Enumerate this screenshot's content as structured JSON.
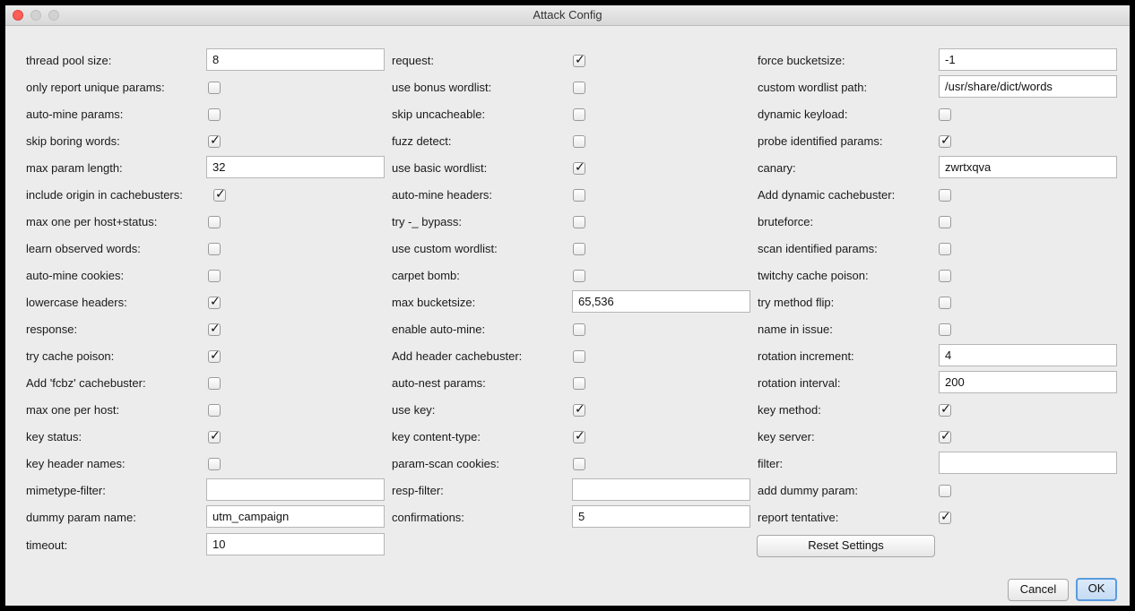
{
  "window": {
    "title": "Attack Config"
  },
  "col1": {
    "thread_pool_size": {
      "label": "thread pool size:",
      "value": "8"
    },
    "only_report_unique_params": {
      "label": "only report unique params:",
      "checked": false
    },
    "auto_mine_params": {
      "label": "auto-mine params:",
      "checked": false
    },
    "skip_boring_words": {
      "label": "skip boring words:",
      "checked": true
    },
    "max_param_length": {
      "label": "max param length:",
      "value": "32"
    },
    "include_origin_in_cachebusters": {
      "label": "include origin in cachebusters:",
      "checked": true
    },
    "max_one_per_host_status": {
      "label": "max one per host+status:",
      "checked": false
    },
    "learn_observed_words": {
      "label": "learn observed words:",
      "checked": false
    },
    "auto_mine_cookies": {
      "label": "auto-mine cookies:",
      "checked": false
    },
    "lowercase_headers": {
      "label": "lowercase headers:",
      "checked": true
    },
    "response": {
      "label": "response:",
      "checked": true
    },
    "try_cache_poison": {
      "label": "try cache poison:",
      "checked": true
    },
    "add_fcbz_cachebuster": {
      "label": "Add 'fcbz' cachebuster:",
      "checked": false
    },
    "max_one_per_host": {
      "label": "max one per host:",
      "checked": false
    },
    "key_status": {
      "label": "key status:",
      "checked": true
    },
    "key_header_names": {
      "label": "key header names:",
      "checked": false
    },
    "mimetype_filter": {
      "label": "mimetype-filter:",
      "value": ""
    },
    "dummy_param_name": {
      "label": "dummy param name:",
      "value": "utm_campaign"
    },
    "timeout": {
      "label": "timeout:",
      "value": "10"
    }
  },
  "col2": {
    "request": {
      "label": "request:",
      "checked": true
    },
    "use_bonus_wordlist": {
      "label": "use bonus wordlist:",
      "checked": false
    },
    "skip_uncacheable": {
      "label": "skip uncacheable:",
      "checked": false
    },
    "fuzz_detect": {
      "label": "fuzz detect:",
      "checked": false
    },
    "use_basic_wordlist": {
      "label": "use basic wordlist:",
      "checked": true
    },
    "auto_mine_headers": {
      "label": "auto-mine headers:",
      "checked": false
    },
    "try_bypass": {
      "label": "try -_ bypass:",
      "checked": false
    },
    "use_custom_wordlist": {
      "label": "use custom wordlist:",
      "checked": false
    },
    "carpet_bomb": {
      "label": "carpet bomb:",
      "checked": false
    },
    "max_bucketsize": {
      "label": "max bucketsize:",
      "value": "65,536"
    },
    "enable_auto_mine": {
      "label": "enable auto-mine:",
      "checked": false
    },
    "add_header_cachebuster": {
      "label": "Add header cachebuster:",
      "checked": false
    },
    "auto_nest_params": {
      "label": "auto-nest params:",
      "checked": false
    },
    "use_key": {
      "label": "use key:",
      "checked": true
    },
    "key_content_type": {
      "label": "key content-type:",
      "checked": true
    },
    "param_scan_cookies": {
      "label": "param-scan cookies:",
      "checked": false
    },
    "resp_filter": {
      "label": "resp-filter:",
      "value": ""
    },
    "confirmations": {
      "label": "confirmations:",
      "value": "5"
    }
  },
  "col3": {
    "force_bucketsize": {
      "label": "force bucketsize:",
      "value": "-1"
    },
    "custom_wordlist_path": {
      "label": "custom wordlist path:",
      "value": "/usr/share/dict/words"
    },
    "dynamic_keyload": {
      "label": "dynamic keyload:",
      "checked": false
    },
    "probe_identified_params": {
      "label": "probe identified params:",
      "checked": true
    },
    "canary": {
      "label": "canary:",
      "value": "zwrtxqva"
    },
    "add_dynamic_cachebuster": {
      "label": "Add dynamic cachebuster:",
      "checked": false
    },
    "bruteforce": {
      "label": "bruteforce:",
      "checked": false
    },
    "scan_identified_params": {
      "label": "scan identified params:",
      "checked": false
    },
    "twitchy_cache_poison": {
      "label": "twitchy cache poison:",
      "checked": false
    },
    "try_method_flip": {
      "label": "try method flip:",
      "checked": false
    },
    "name_in_issue": {
      "label": "name in issue:",
      "checked": false
    },
    "rotation_increment": {
      "label": "rotation increment:",
      "value": "4"
    },
    "rotation_interval": {
      "label": "rotation interval:",
      "value": "200"
    },
    "key_method": {
      "label": "key method:",
      "checked": true
    },
    "key_server": {
      "label": "key server:",
      "checked": true
    },
    "filter": {
      "label": "filter:",
      "value": ""
    },
    "add_dummy_param": {
      "label": "add dummy param:",
      "checked": false
    },
    "report_tentative": {
      "label": "report tentative:",
      "checked": true
    }
  },
  "buttons": {
    "reset": "Reset Settings",
    "cancel": "Cancel",
    "ok": "OK"
  },
  "glyphs": {
    "check": "✓"
  }
}
